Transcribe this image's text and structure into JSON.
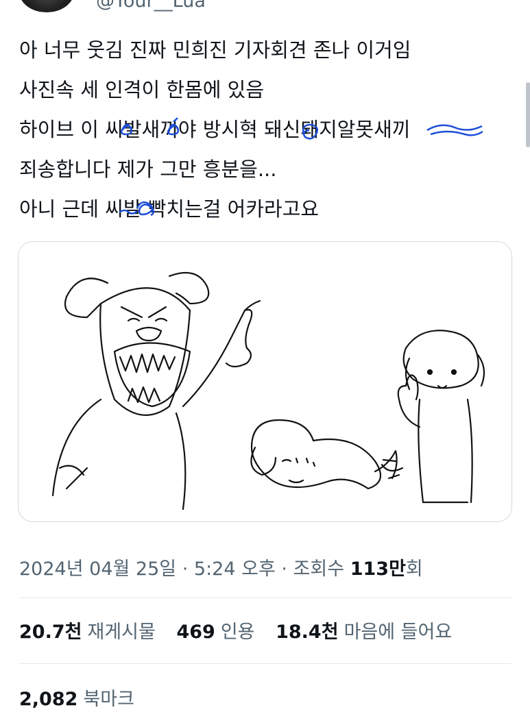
{
  "header": {
    "handle": "@Your__Lua"
  },
  "tweet": {
    "lines": [
      "아 너무 웃김 진짜 민희진 기자회견 존나 이거임",
      "사진속 세 인격이 한몸에 있음",
      "하이브 이 씨발새끼야 방시혁 돼신돼지알못새끼",
      "죄송합니다 제가 그만 흥분을...",
      "아니 근데 씨발 빡치는걸 어카라고요"
    ]
  },
  "meta": {
    "date": "2024년 04월 25일",
    "sep": "·",
    "time": "5:24 오후",
    "views_label": "조회수",
    "views_value": "113만",
    "views_suffix": "회"
  },
  "stats": {
    "retweets_value": "20.7천",
    "retweets_label": "재게시물",
    "quotes_value": "469",
    "quotes_label": "인용",
    "likes_value": "18.4천",
    "likes_label": "마음에 들어요"
  },
  "bookmarks": {
    "value": "2,082",
    "label": "북마크"
  },
  "colors": {
    "text": "#0f1419",
    "muted": "#536471",
    "border": "#cfd9de",
    "scribble": "#1d4ed8"
  }
}
